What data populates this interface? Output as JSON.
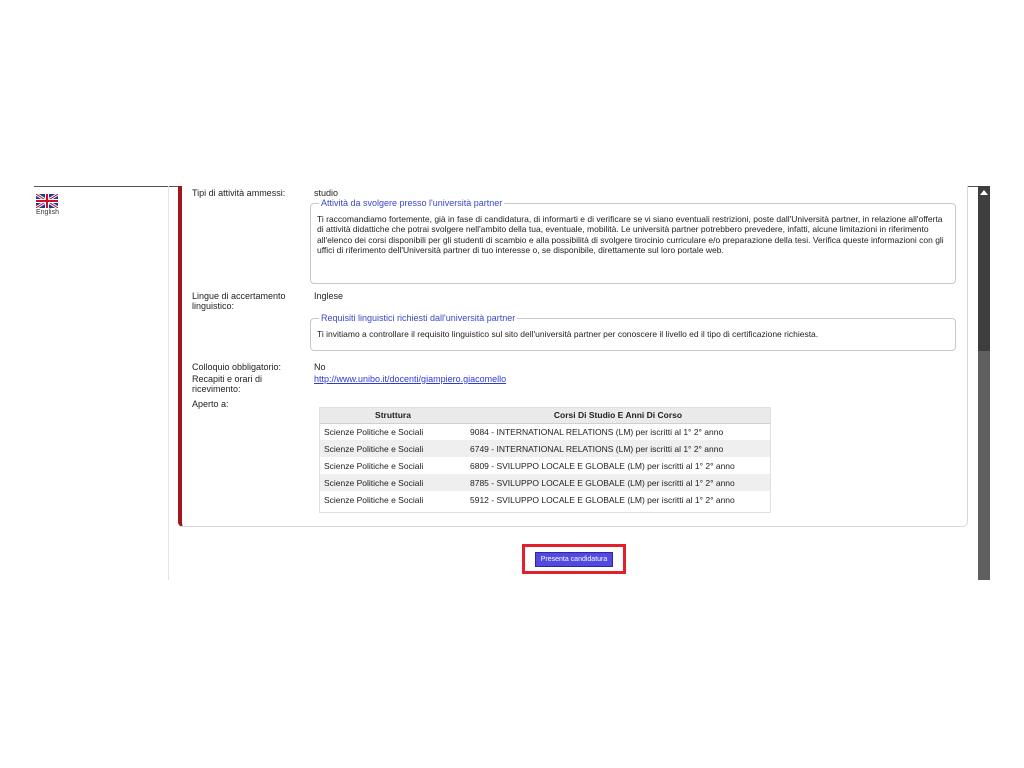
{
  "language": {
    "label": "English"
  },
  "details": {
    "activity_types_label": "Tipi di attività ammessi:",
    "activity_types_value": "studio",
    "activity_note_legend": "Attività da svolgere presso l'università partner",
    "activity_note_text": "Ti raccomandiamo fortemente, già in fase di candidatura, di informarti e di verificare se vi siano eventuali restrizioni, poste dall'Università partner, in relazione all'offerta di attività didattiche che potrai svolgere nell'ambito della tua, eventuale, mobilità. Le università partner potrebbero prevedere, infatti, alcune limitazioni in riferimento all'elenco dei corsi disponibili per gli studenti di scambio e alla possibilità di svolgere tirocinio curriculare e/o preparazione della tesi. Verifica queste informazioni con gli uffici di riferimento dell'Università partner di tuo interesse o, se disponibile, direttamente sul loro portale web.",
    "language_check_label": "Lingue di accertamento linguistico:",
    "language_check_value": "Inglese",
    "language_note_legend": "Requisiti linguistici richiesti dall'università partner",
    "language_note_text": "Ti invitiamo a controllare il requisito linguistico sul sito dell'università partner per conoscere il livello ed il tipo di certificazione richiesta.",
    "interview_label": "Colloquio obbligatorio:",
    "interview_value": "No",
    "contacts_label": "Recapiti e orari di ricevimento:",
    "contacts_link": "http://www.unibo.it/docenti/giampiero.giacomello",
    "open_to_label": "Aperto a:"
  },
  "courses_table": {
    "headers": [
      "Struttura",
      "Corsi Di Studio E Anni Di Corso"
    ],
    "rows": [
      [
        "Scienze Politiche e Sociali",
        "9084 - INTERNATIONAL RELATIONS (LM) per iscritti al 1° 2° anno"
      ],
      [
        "Scienze Politiche e Sociali",
        "6749 - INTERNATIONAL RELATIONS (LM) per iscritti al 1° 2° anno"
      ],
      [
        "Scienze Politiche e Sociali",
        "6809 - SVILUPPO LOCALE E GLOBALE (LM) per iscritti al 1° 2° anno"
      ],
      [
        "Scienze Politiche e Sociali",
        "8785 - SVILUPPO LOCALE E GLOBALE (LM) per iscritti al 1° 2° anno"
      ],
      [
        "Scienze Politiche e Sociali",
        "5912 - SVILUPPO LOCALE E GLOBALE (LM) per iscritti al 1° 2° anno"
      ]
    ]
  },
  "submit": {
    "label": "Presenta candidatura"
  },
  "colors": {
    "panel_accent": "#a0161b",
    "legend": "#3b47c8",
    "button": "#5249e0",
    "highlight": "#e2202b"
  }
}
